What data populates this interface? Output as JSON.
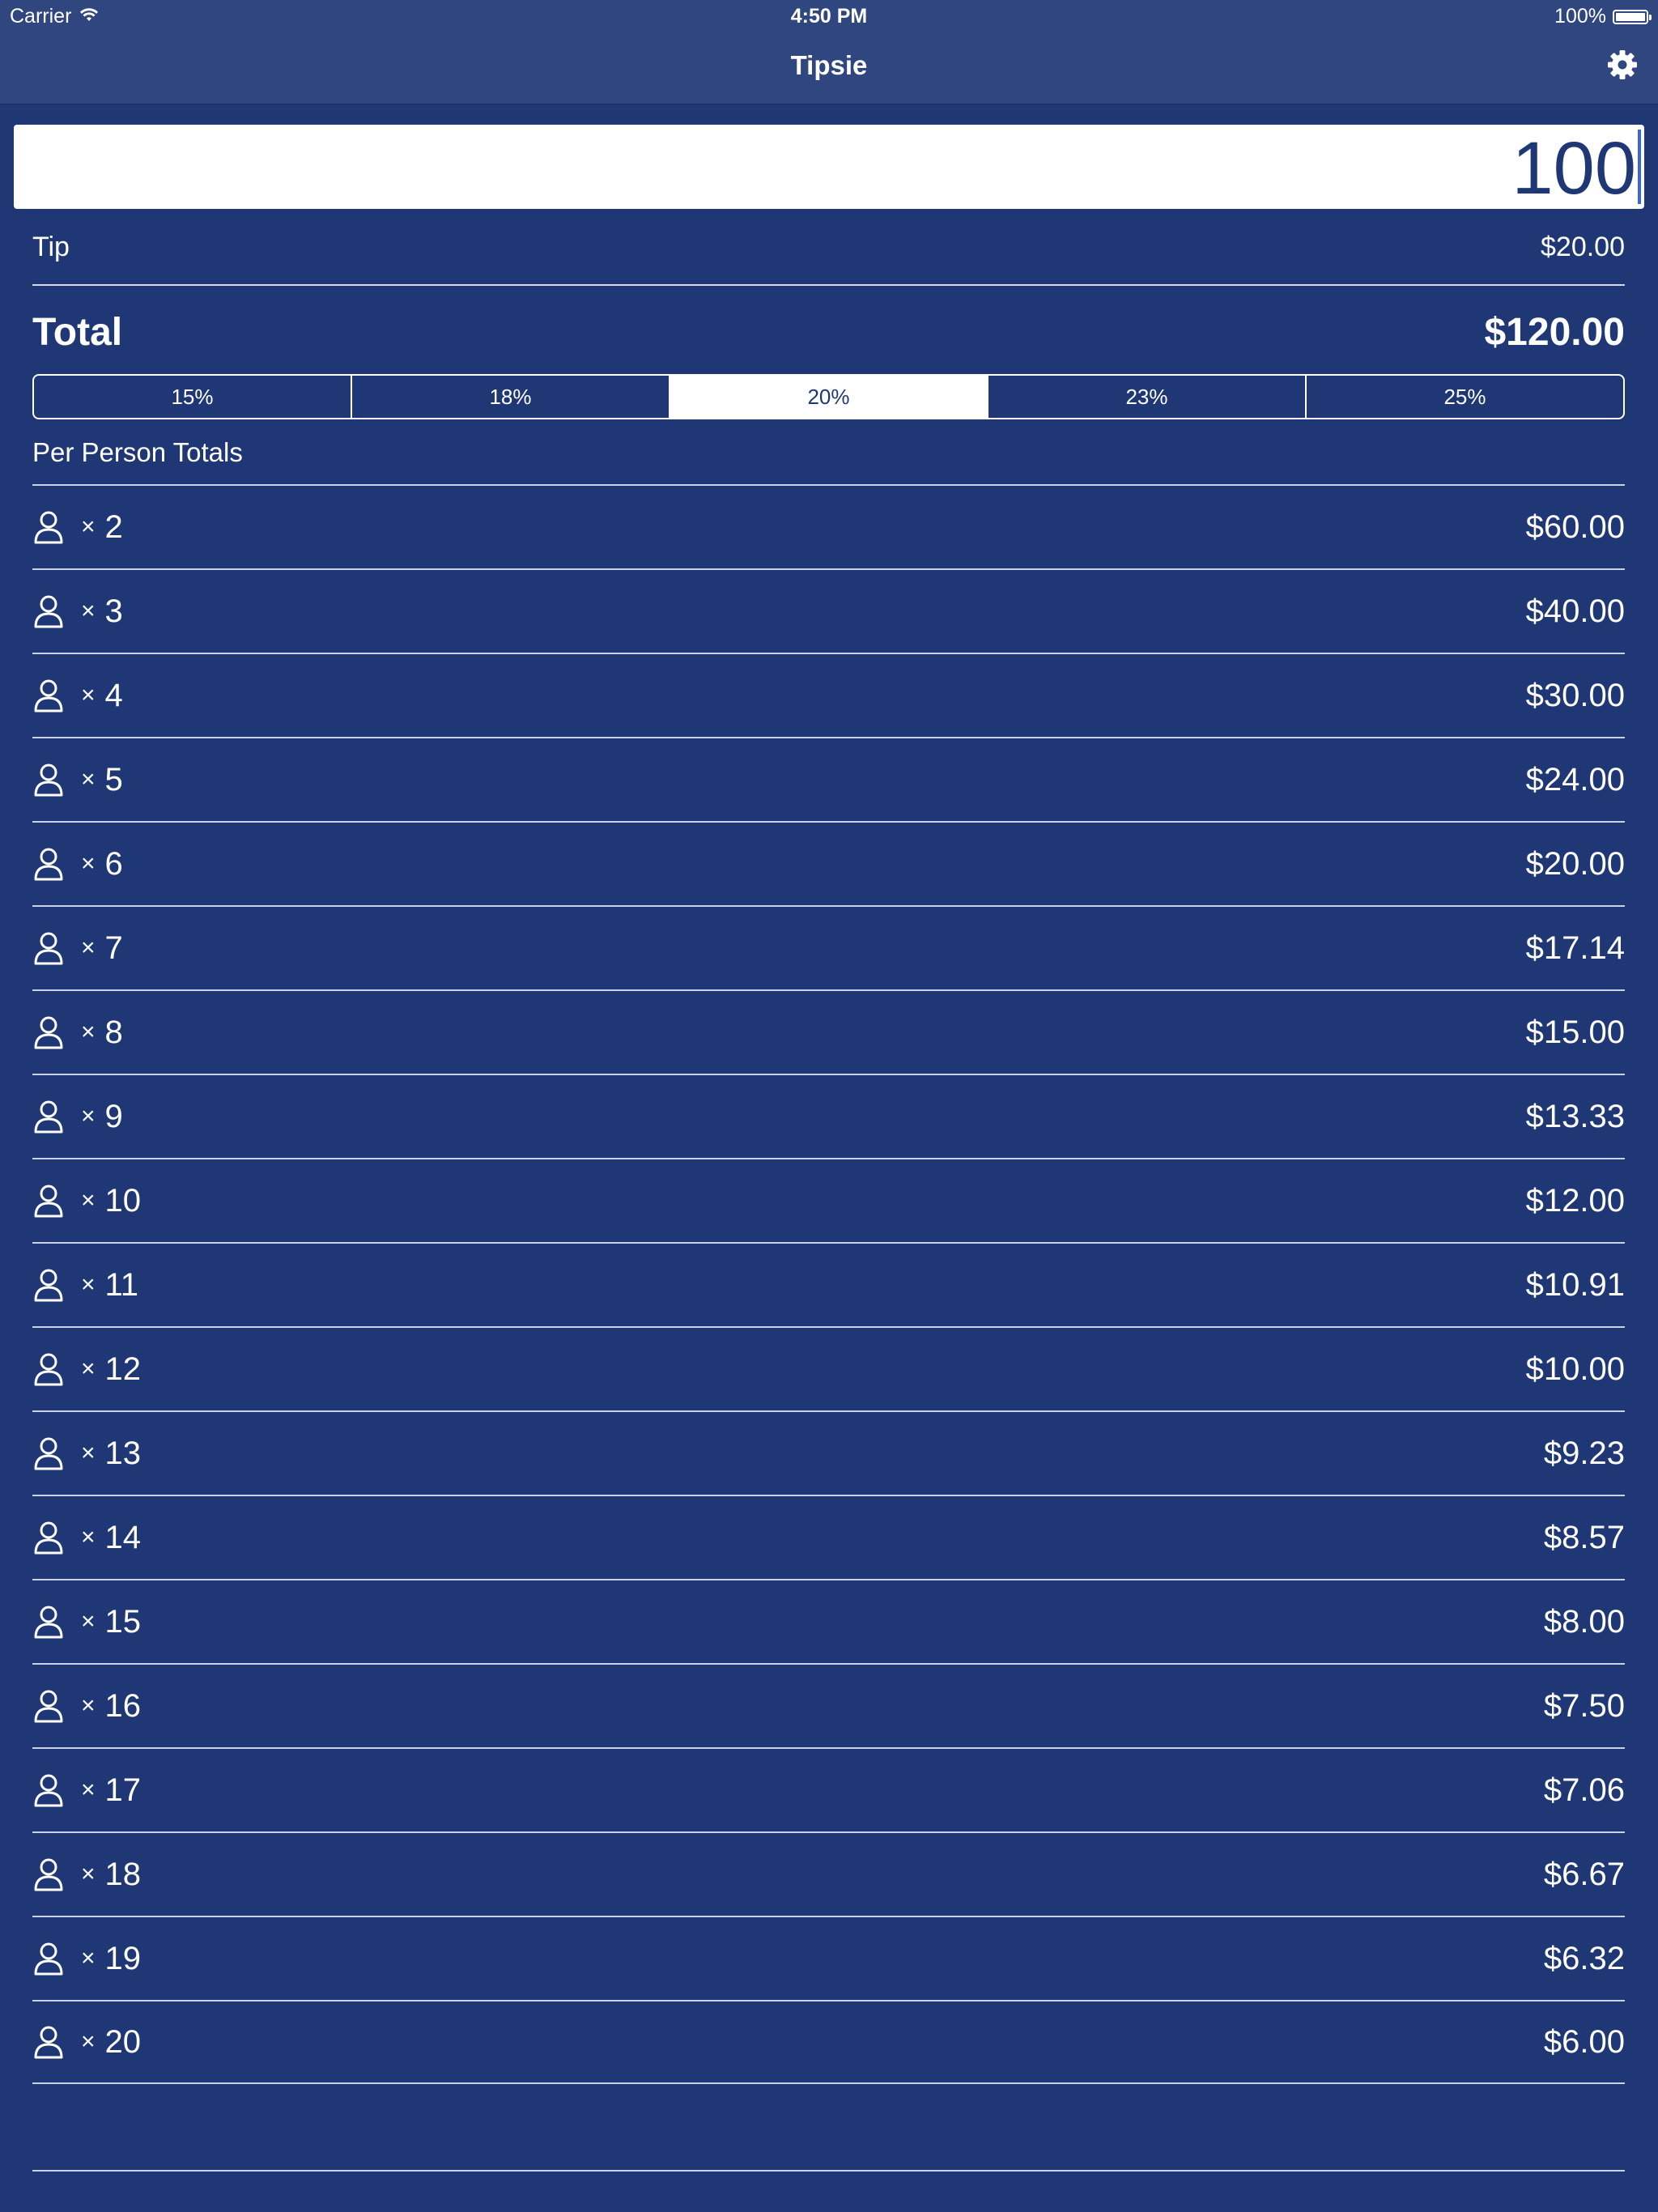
{
  "status_bar": {
    "carrier": "Carrier",
    "time": "4:50 PM",
    "battery_percent_label": "100%",
    "battery_level": 1.0
  },
  "nav": {
    "title": "Tipsie",
    "settings_icon": "gear-icon"
  },
  "bill": {
    "amount": "100"
  },
  "summary": {
    "tip_label": "Tip",
    "tip_value": "$20.00",
    "total_label": "Total",
    "total_value": "$120.00"
  },
  "tip_options": {
    "items": [
      "15%",
      "18%",
      "20%",
      "23%",
      "25%"
    ],
    "selected_index": 2
  },
  "per_person": {
    "header": "Per Person Totals",
    "times_symbol": "×",
    "person_icon": "person-icon",
    "rows": [
      {
        "count": "2",
        "amount": "$60.00"
      },
      {
        "count": "3",
        "amount": "$40.00"
      },
      {
        "count": "4",
        "amount": "$30.00"
      },
      {
        "count": "5",
        "amount": "$24.00"
      },
      {
        "count": "6",
        "amount": "$20.00"
      },
      {
        "count": "7",
        "amount": "$17.14"
      },
      {
        "count": "8",
        "amount": "$15.00"
      },
      {
        "count": "9",
        "amount": "$13.33"
      },
      {
        "count": "10",
        "amount": "$12.00"
      },
      {
        "count": "11",
        "amount": "$10.91"
      },
      {
        "count": "12",
        "amount": "$10.00"
      },
      {
        "count": "13",
        "amount": "$9.23"
      },
      {
        "count": "14",
        "amount": "$8.57"
      },
      {
        "count": "15",
        "amount": "$8.00"
      },
      {
        "count": "16",
        "amount": "$7.50"
      },
      {
        "count": "17",
        "amount": "$7.06"
      },
      {
        "count": "18",
        "amount": "$6.67"
      },
      {
        "count": "19",
        "amount": "$6.32"
      },
      {
        "count": "20",
        "amount": "$6.00"
      }
    ]
  },
  "colors": {
    "background": "#1f3775",
    "bar": "#30467f",
    "text": "#ffffff"
  }
}
